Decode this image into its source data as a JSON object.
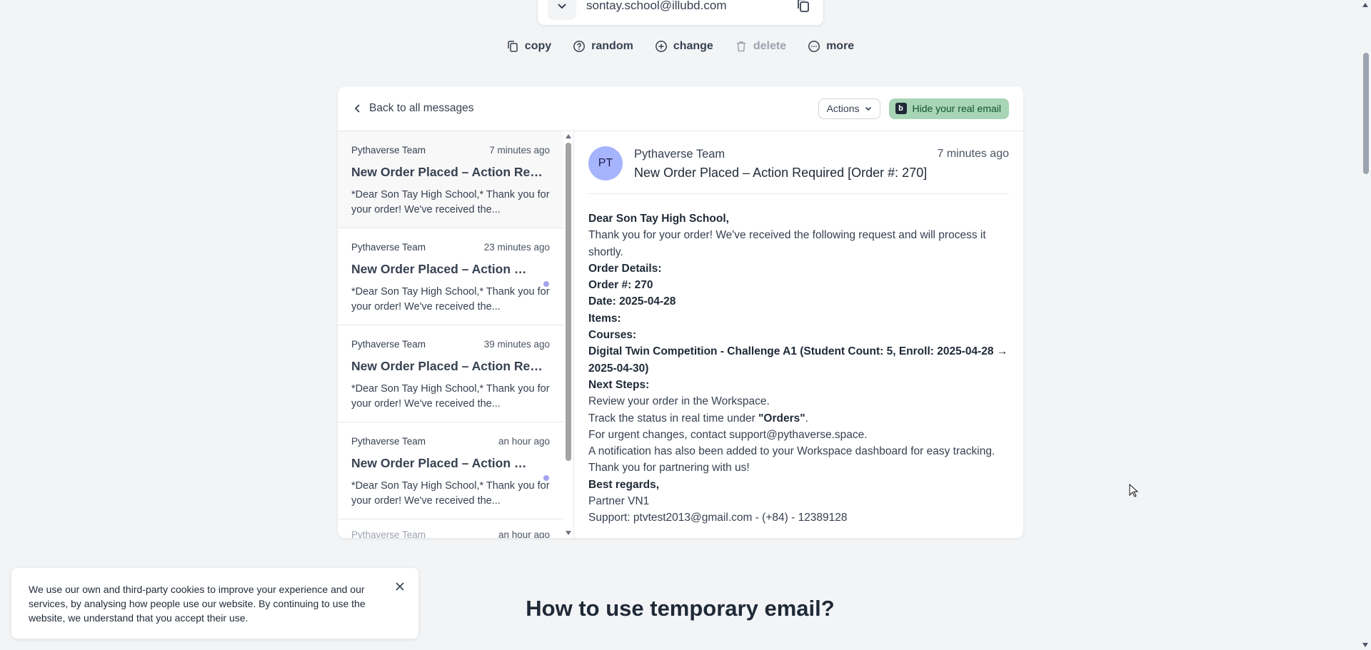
{
  "email": {
    "address": "sontay.school@illubd.com"
  },
  "toolbar": {
    "copy": "copy",
    "random": "random",
    "change": "change",
    "delete": "delete",
    "more": "more"
  },
  "card": {
    "back_label": "Back to all messages",
    "actions_label": "Actions",
    "hide_label": "Hide your real email",
    "hide_logo": "b"
  },
  "messages": [
    {
      "sender": "Pythaverse Team",
      "time": "7 minutes ago",
      "subject": "New Order Placed – Action Required [Order #: 270]",
      "preview": "*Dear Son Tay High School,* Thank you for your order! We've received the...",
      "unread": false
    },
    {
      "sender": "Pythaverse Team",
      "time": "23 minutes ago",
      "subject": "New Order Placed – Action Required",
      "preview": "*Dear Son Tay High School,* Thank you for your order! We've received the...",
      "unread": true
    },
    {
      "sender": "Pythaverse Team",
      "time": "39 minutes ago",
      "subject": "New Order Placed – Action Required",
      "preview": "*Dear Son Tay High School,* Thank you for your order! We've received the...",
      "unread": false
    },
    {
      "sender": "Pythaverse Team",
      "time": "an hour ago",
      "subject": "New Order Placed – Action Required",
      "preview": "*Dear Son Tay High School,* Thank you for your order! We've received the...",
      "unread": true
    },
    {
      "sender": "Pythaverse Team",
      "time": "an hour ago"
    }
  ],
  "reader": {
    "avatar": "PT",
    "sender": "Pythaverse Team",
    "subject": "New Order Placed – Action Required [Order #: 270]",
    "time": "7 minutes ago",
    "greeting": "Dear Son Tay High School,",
    "intro": "Thank you for your order! We've received the following request and will process it shortly.",
    "order_details": "Order Details:",
    "order_no": "Order #: 270",
    "date": "Date: 2025-04-28",
    "items": "Items:",
    "courses": "Courses:",
    "course_line": "Digital Twin Competition - Challenge A1 (Student Count: 5, Enroll: 2025-04-28 → 2025-04-30)",
    "next_steps": "Next Steps:",
    "step1": "Review your order in the Workspace.",
    "step2_pre": "Track the status in real time under ",
    "step2_bold": "\"Orders\"",
    "step2_post": ".",
    "step3": "For urgent changes, contact support@pythaverse.space.",
    "notification": "A notification has also been added to your Workspace dashboard for easy tracking.",
    "thanks": "Thank you for partnering with us!",
    "regards": "Best regards,",
    "signature": "Partner VN1",
    "support": "Support: ptvtest2013@gmail.com - (+84) - 12389128"
  },
  "how_title": "How to use temporary email?",
  "cookie": {
    "text": "We use our own and third-party cookies to improve your experience and our services, by analysing how people use our website. By continuing to use the website, we understand that you accept their use."
  }
}
